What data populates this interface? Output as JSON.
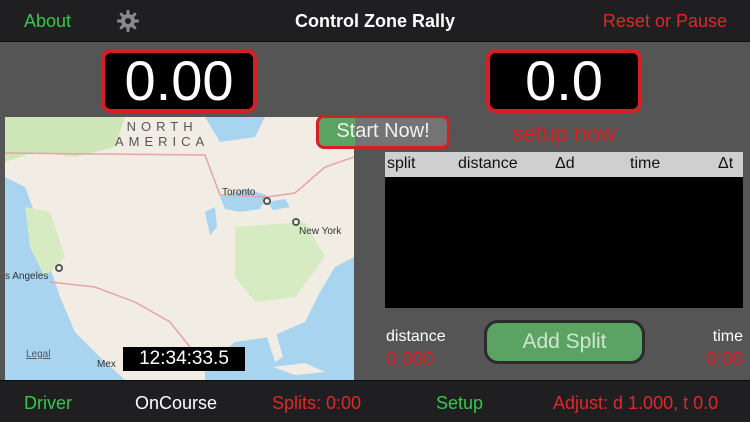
{
  "header": {
    "about_label": "About",
    "title": "Control Zone Rally",
    "reset_label": "Reset or Pause",
    "gear_icon": "gear-icon"
  },
  "displays": {
    "left_value": "0.00",
    "right_value": "0.0",
    "setup_text": "setup now"
  },
  "start_button_label": "Start Now!",
  "map": {
    "region_line1": "NORTH",
    "region_line2": "AMERICA",
    "cities": [
      "Toronto",
      "New York",
      "s Angeles",
      "Mex"
    ],
    "legal_label": "Legal",
    "clock": "12:34:33.5",
    "colors": {
      "land": "#f1ede4",
      "water": "#a8d4f0",
      "green": "#cfe6b8",
      "border": "#e7a3a5"
    }
  },
  "splits_table": {
    "columns": [
      "split",
      "distance",
      "Δd",
      "time",
      "Δt"
    ],
    "rows": []
  },
  "summary": {
    "distance_label": "distance",
    "distance_value": "0.000",
    "time_label": "time",
    "time_value": "0:00"
  },
  "add_split_label": "Add Split",
  "footer": {
    "driver": "Driver",
    "oncourse": "OnCourse",
    "splits": "Splits: 0:00",
    "setup": "Setup",
    "adjust": "Adjust: d 1.000, t 0.0"
  },
  "colors": {
    "accent_green": "#34c749",
    "accent_red": "#e0282a",
    "button_green": "#5aa363"
  }
}
